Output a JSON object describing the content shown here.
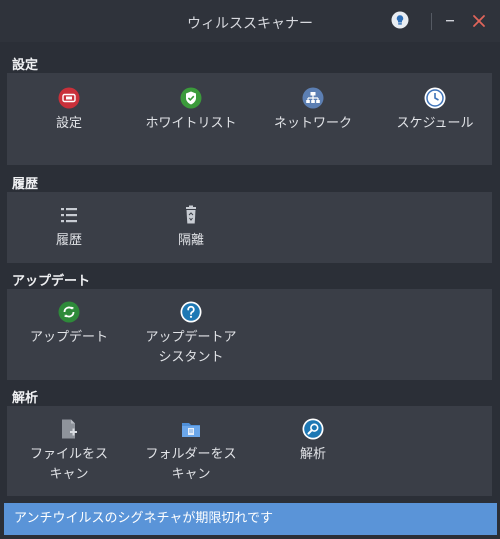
{
  "window": {
    "title": "ウィルススキャナー"
  },
  "sections": {
    "settings": {
      "title": "設定",
      "items": [
        {
          "label": "設定",
          "icon": "settings-icon"
        },
        {
          "label": "ホワイトリスト",
          "icon": "shield-check-icon"
        },
        {
          "label": "ネットワーク",
          "icon": "network-icon"
        },
        {
          "label": "スケジュール",
          "icon": "clock-icon"
        }
      ]
    },
    "history": {
      "title": "履歴",
      "items": [
        {
          "label": "履歴",
          "icon": "list-icon"
        },
        {
          "label": "隔離",
          "icon": "trash-icon"
        }
      ]
    },
    "update": {
      "title": "アップデート",
      "items": [
        {
          "label": "アップデート",
          "icon": "refresh-icon"
        },
        {
          "label": "アップデートアシスタント",
          "label_lines": [
            "アップデートア",
            "シスタント"
          ],
          "icon": "help-icon"
        }
      ]
    },
    "scan": {
      "title": "解析",
      "items": [
        {
          "label": "ファイルをスキャン",
          "label_lines": [
            "ファイルをス",
            "キャン"
          ],
          "icon": "file-scan-icon"
        },
        {
          "label": "フォルダーをスキャン",
          "label_lines": [
            "フォルダーをス",
            "キャン"
          ],
          "icon": "folder-scan-icon"
        },
        {
          "label": "解析",
          "icon": "magnifier-icon"
        }
      ]
    }
  },
  "status": {
    "message": "アンチウイルスのシグネチャが期限切れです"
  }
}
